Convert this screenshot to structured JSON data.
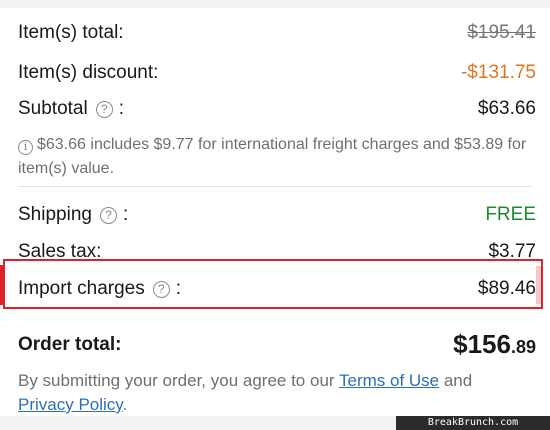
{
  "items_total": {
    "label": "Item(s) total:",
    "value": "$195.41"
  },
  "items_discount": {
    "label": "Item(s) discount:",
    "value": "-$131.75"
  },
  "subtotal": {
    "label": "Subtotal",
    "colon": ":",
    "value": "$63.66"
  },
  "freight_note": {
    "text": "$63.66 includes $9.77 for international freight charges and $53.89 for item(s) value."
  },
  "shipping": {
    "label": "Shipping",
    "colon": ":",
    "value": "FREE"
  },
  "sales_tax": {
    "label": "Sales tax:",
    "value": "$3.77"
  },
  "import_charges": {
    "label": "Import charges",
    "colon": ":",
    "value": "$89.46"
  },
  "order_total": {
    "label": "Order total:",
    "value_main": "$156",
    "value_cents": ".89"
  },
  "legal": {
    "prefix": "By submitting your order, you agree to our ",
    "terms_link": "Terms of Use",
    "middle": " and ",
    "privacy_link": "Privacy Policy",
    "suffix": "."
  },
  "watermark": {
    "text": "BreakBrunch.com"
  },
  "icons": {
    "question": "question-circle-icon",
    "info": "info-circle-icon"
  },
  "colors": {
    "discount": "#e0751e",
    "free": "#1f8a2f",
    "highlight": "#d9242b",
    "link": "#2d6fb6"
  }
}
